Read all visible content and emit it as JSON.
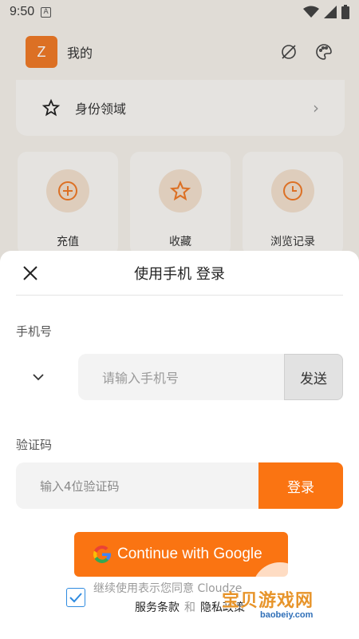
{
  "status_bar": {
    "time": "9:50",
    "badge": "A"
  },
  "background_page": {
    "avatar_letter": "Z",
    "title": "我的",
    "identity_label": "身份领域",
    "tiles": [
      {
        "label": "充值",
        "icon": "plus-circle-icon"
      },
      {
        "label": "收藏",
        "icon": "star-icon"
      },
      {
        "label": "浏览记录",
        "icon": "clock-icon"
      }
    ]
  },
  "sheet": {
    "title": "使用手机 登录",
    "phone_label": "手机号",
    "phone_placeholder": "请输入手机号",
    "send_label": "发送",
    "code_label": "验证码",
    "code_placeholder": "输入4位验证码",
    "login_label": "登录",
    "google_label": "Continue with Google",
    "agree_prefix": "继续使用表示您同意 Cloudze",
    "terms_label": "服务条款",
    "and_label": "和",
    "privacy_label": "隐私政策",
    "agreed": true
  },
  "watermark": {
    "text": "宝贝游戏网",
    "url": "baobeiy.com"
  },
  "colors": {
    "accent": "#fa7412",
    "avatar": "#ef7a28",
    "checkbox": "#2f8be0"
  }
}
